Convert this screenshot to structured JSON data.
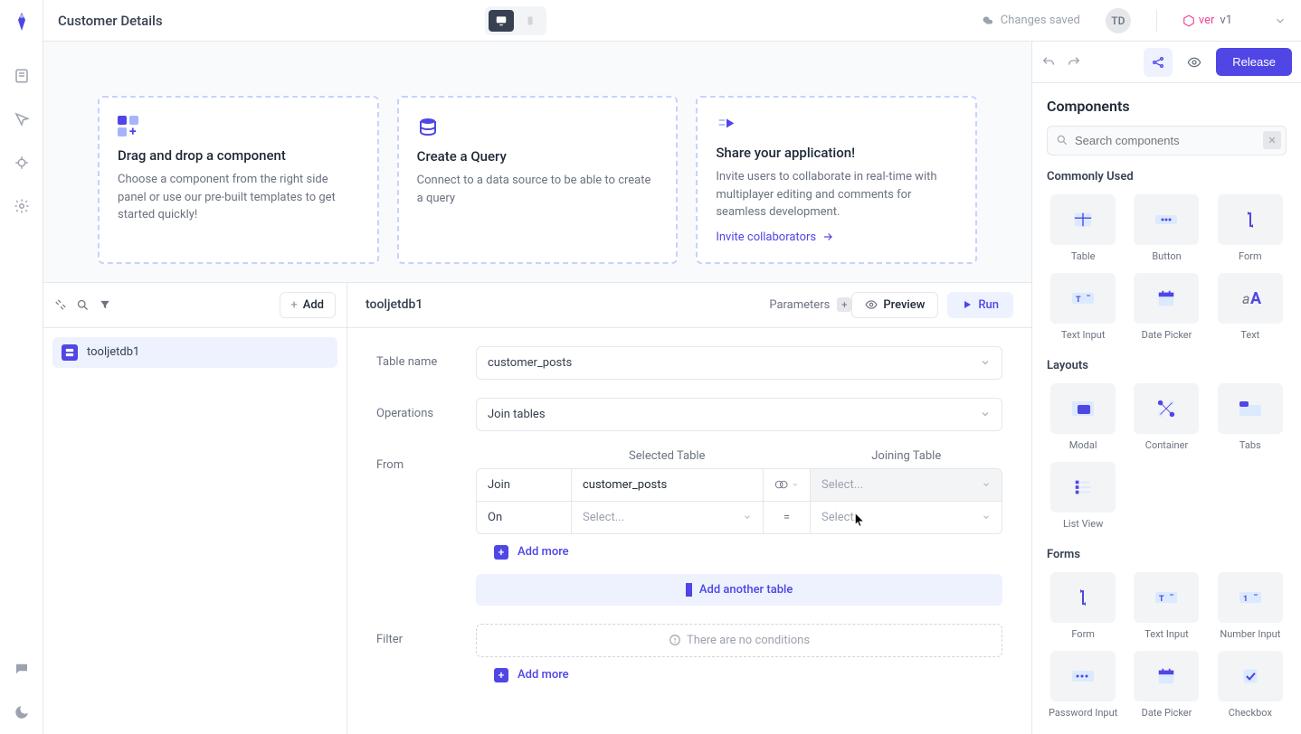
{
  "header": {
    "title": "Customer Details",
    "saved": "Changes saved",
    "avatar": "TD",
    "ver_label": "ver",
    "ver_value": "v1",
    "release": "Release"
  },
  "hero": {
    "card1": {
      "title": "Drag and drop a component",
      "desc": "Choose a component from the right side panel or use our pre-built templates to get started quickly!"
    },
    "card2": {
      "title": "Create a Query",
      "desc": "Connect to a data source to be able to create a query"
    },
    "card3": {
      "title": "Share your application!",
      "desc": "Invite users to collaborate in real-time with multiplayer editing and comments for seamless development.",
      "link": "Invite collaborators"
    }
  },
  "query_sidebar": {
    "add": "Add",
    "items": [
      {
        "label": "tooljetdb1"
      }
    ]
  },
  "query_body": {
    "title": "tooljetdb1",
    "params": "Parameters",
    "preview": "Preview",
    "run": "Run",
    "labels": {
      "table_name": "Table name",
      "operations": "Operations",
      "from": "From",
      "filter": "Filter",
      "selected_table": "Selected Table",
      "joining_table": "Joining Table",
      "join": "Join",
      "on": "On",
      "eq": "="
    },
    "table_name_value": "customer_posts",
    "operations_value": "Join tables",
    "selected_table_value": "customer_posts",
    "select_placeholder": "Select...",
    "add_more": "Add more",
    "add_another_table": "Add another table",
    "no_conditions": "There are no conditions"
  },
  "right_panel": {
    "title": "Components",
    "search_placeholder": "Search components",
    "sections": {
      "commonly_used": "Commonly Used",
      "layouts": "Layouts",
      "forms": "Forms"
    },
    "commonly_used": [
      {
        "label": "Table"
      },
      {
        "label": "Button"
      },
      {
        "label": "Form"
      },
      {
        "label": "Text Input"
      },
      {
        "label": "Date Picker"
      },
      {
        "label": "Text"
      }
    ],
    "layouts": [
      {
        "label": "Modal"
      },
      {
        "label": "Container"
      },
      {
        "label": "Tabs"
      },
      {
        "label": "List View"
      }
    ],
    "forms": [
      {
        "label": "Form"
      },
      {
        "label": "Text Input"
      },
      {
        "label": "Number Input"
      },
      {
        "label": "Password Input"
      },
      {
        "label": "Date Picker"
      },
      {
        "label": "Checkbox"
      }
    ]
  }
}
